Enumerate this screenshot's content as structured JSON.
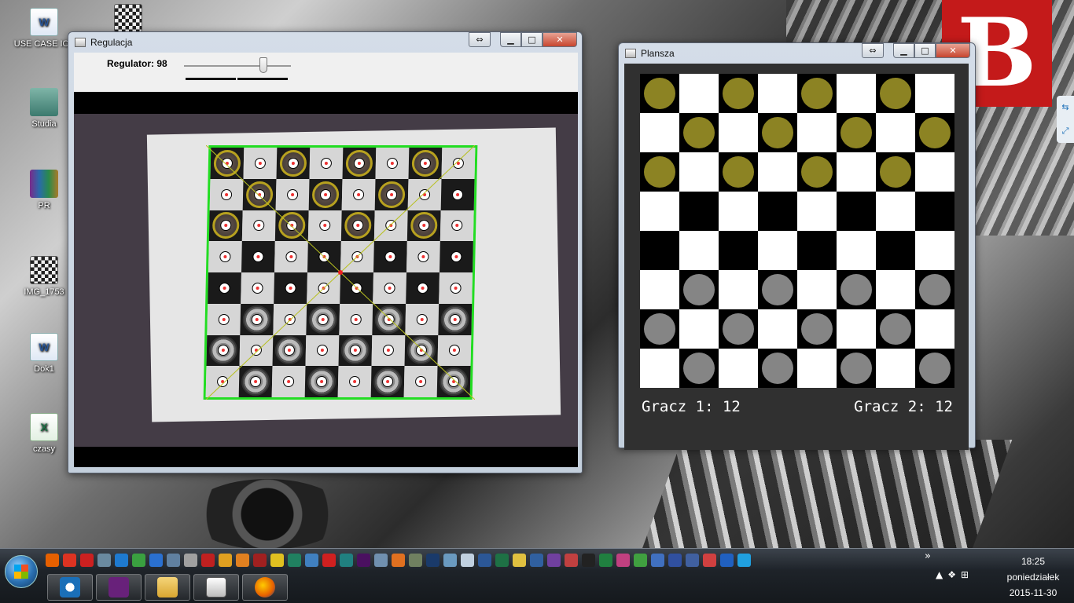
{
  "desktop_icons": [
    {
      "label": "USE CASE IO_",
      "icon": "word-doc-icon"
    },
    {
      "label": "",
      "icon": "chessboard-image-icon"
    },
    {
      "label": "Studia",
      "icon": "shortcut-folder-icon"
    },
    {
      "label": "PR",
      "icon": "winrar-archive-icon"
    },
    {
      "label": "IMG_1753",
      "icon": "chessboard-image-icon"
    },
    {
      "label": "Dok1",
      "icon": "word-doc-icon"
    },
    {
      "label": "czasy",
      "icon": "excel-sheet-icon"
    }
  ],
  "regulacja": {
    "title": "Regulacja",
    "regulator_label": "Regulator: 98",
    "regulator_value": 98,
    "regulator_max": 128
  },
  "plansza": {
    "title": "Plansza",
    "score_p1": "Gracz 1: 12",
    "score_p2": "Gracz 2: 12"
  },
  "board_layout": [
    [
      1,
      0,
      1,
      0,
      1,
      0,
      1,
      0
    ],
    [
      0,
      1,
      0,
      1,
      0,
      1,
      0,
      1
    ],
    [
      1,
      0,
      1,
      0,
      1,
      0,
      1,
      0
    ],
    [
      0,
      0,
      0,
      0,
      0,
      0,
      0,
      0
    ],
    [
      0,
      0,
      0,
      0,
      0,
      0,
      0,
      0
    ],
    [
      0,
      2,
      0,
      2,
      0,
      2,
      0,
      2
    ],
    [
      2,
      0,
      2,
      0,
      2,
      0,
      2,
      0
    ],
    [
      0,
      2,
      0,
      2,
      0,
      2,
      0,
      2
    ]
  ],
  "photo_layout": [
    [
      1,
      0,
      1,
      0,
      1,
      0,
      1,
      0
    ],
    [
      0,
      1,
      0,
      1,
      0,
      1,
      0,
      0
    ],
    [
      1,
      0,
      1,
      0,
      1,
      0,
      1,
      0
    ],
    [
      0,
      0,
      0,
      0,
      0,
      0,
      0,
      0
    ],
    [
      0,
      0,
      0,
      0,
      0,
      0,
      0,
      0
    ],
    [
      0,
      2,
      0,
      2,
      0,
      2,
      0,
      2
    ],
    [
      2,
      0,
      2,
      0,
      2,
      0,
      2,
      0
    ],
    [
      0,
      2,
      0,
      2,
      0,
      2,
      0,
      2
    ]
  ],
  "colors": {
    "player1": "#8c8323",
    "player2": "#858585",
    "board_outline": "#22dd22"
  },
  "taskbar": {
    "start": "windows-start-orb",
    "pinned": [
      "teamviewer-icon",
      "visual-studio-icon",
      "file-explorer-icon",
      "app-window-icon",
      "firefox-icon"
    ],
    "tray_arrow": "▲",
    "clock_time": "18:25",
    "clock_day": "poniedziałek",
    "clock_date": "2015-11-30",
    "more_arrow": "»"
  }
}
